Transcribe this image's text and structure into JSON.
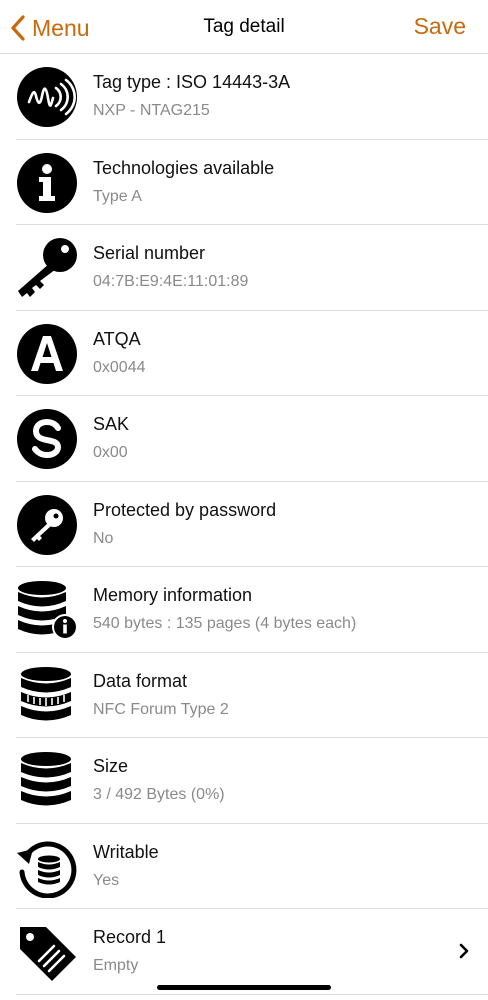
{
  "navbar": {
    "back_label": "Menu",
    "title": "Tag detail",
    "save_label": "Save",
    "accent_color": "#c8690f"
  },
  "rows": [
    {
      "title": "Tag type : ISO 14443-3A",
      "subtitle": "NXP - NTAG215",
      "icon": "nfc-signal-icon"
    },
    {
      "title": "Technologies available",
      "subtitle": "Type A",
      "icon": "info-icon"
    },
    {
      "title": "Serial number",
      "subtitle": "04:7B:E9:4E:11:01:89",
      "icon": "key-icon"
    },
    {
      "title": "ATQA",
      "subtitle": "0x0044",
      "icon": "letter-a-icon"
    },
    {
      "title": "SAK",
      "subtitle": "0x00",
      "icon": "letter-s-icon"
    },
    {
      "title": "Protected by password",
      "subtitle": "No",
      "icon": "password-key-icon"
    },
    {
      "title": "Memory information",
      "subtitle": "540 bytes : 135 pages (4 bytes each)",
      "icon": "database-info-icon"
    },
    {
      "title": "Data format",
      "subtitle": "NFC Forum Type 2",
      "icon": "database-striped-icon"
    },
    {
      "title": "Size",
      "subtitle": "3 / 492 Bytes (0%)",
      "icon": "database-icon"
    },
    {
      "title": "Writable",
      "subtitle": "Yes",
      "icon": "database-refresh-icon"
    },
    {
      "title": "Record 1",
      "subtitle": "Empty",
      "icon": "tag-icon",
      "has_chevron": true
    }
  ]
}
